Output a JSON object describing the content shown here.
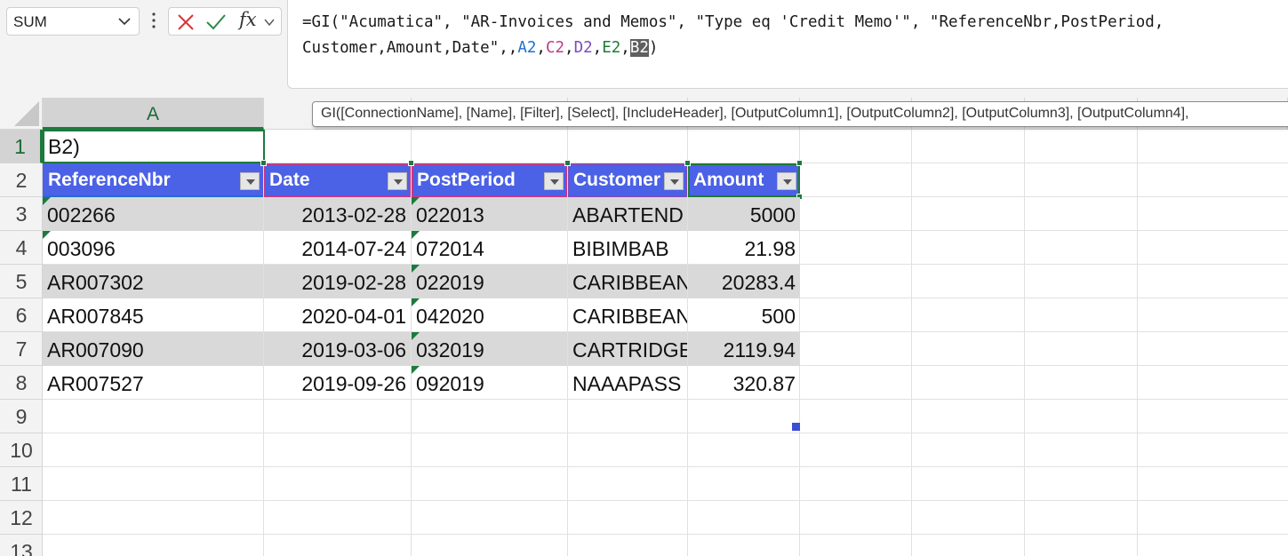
{
  "name_box": {
    "value": "SUM"
  },
  "formula_bar": {
    "line1_text": "=GI(\"Acumatica\", \"AR-Invoices and Memos\", \"Type eq 'Credit Memo'\", \"ReferenceNbr,PostPeriod,",
    "line2_prefix": "Customer,Amount,Date\",,",
    "refs": [
      "A2",
      "C2",
      "D2",
      "E2",
      "B2"
    ],
    "separator": ",",
    "closing": ")"
  },
  "tooltip": {
    "signature": "GI([ConnectionName], [Name], [Filter], [Select], [IncludeHeader], [OutputColumn1], [OutputColumn2], [OutputColumn3], [OutputColumn4],"
  },
  "columns": {
    "a": "A"
  },
  "row_numbers": [
    "1",
    "2",
    "3",
    "4",
    "5",
    "6",
    "7",
    "8",
    "9",
    "10",
    "11",
    "12",
    "13"
  ],
  "cell_a1": "B2)",
  "table": {
    "headers": [
      "ReferenceNbr",
      "Date",
      "PostPeriod",
      "Customer",
      "Amount"
    ],
    "rows": [
      [
        "002266",
        "2013-02-28",
        "022013",
        "ABARTEND",
        "5000"
      ],
      [
        "003096",
        "2014-07-24",
        "072014",
        "BIBIMBAB",
        "21.98"
      ],
      [
        "AR007302",
        "2019-02-28",
        "022019",
        "CARIBBEAN",
        "20283.4"
      ],
      [
        "AR007845",
        "2020-04-01",
        "042020",
        "CARIBBEAN",
        "500"
      ],
      [
        "AR007090",
        "2019-03-06",
        "032019",
        "CARTRIDGE",
        "2119.94"
      ],
      [
        "AR007527",
        "2019-09-26",
        "092019",
        "NAAAPASS",
        "320.87"
      ]
    ]
  },
  "colors": {
    "table_header": "#4b61e6",
    "band": "#d9d9d9",
    "active_green": "#1d7a3f",
    "ref_a": "#1f6fd0",
    "ref_c": "#c0398a",
    "ref_d": "#7b4cc0",
    "ref_e": "#1e7b34"
  }
}
